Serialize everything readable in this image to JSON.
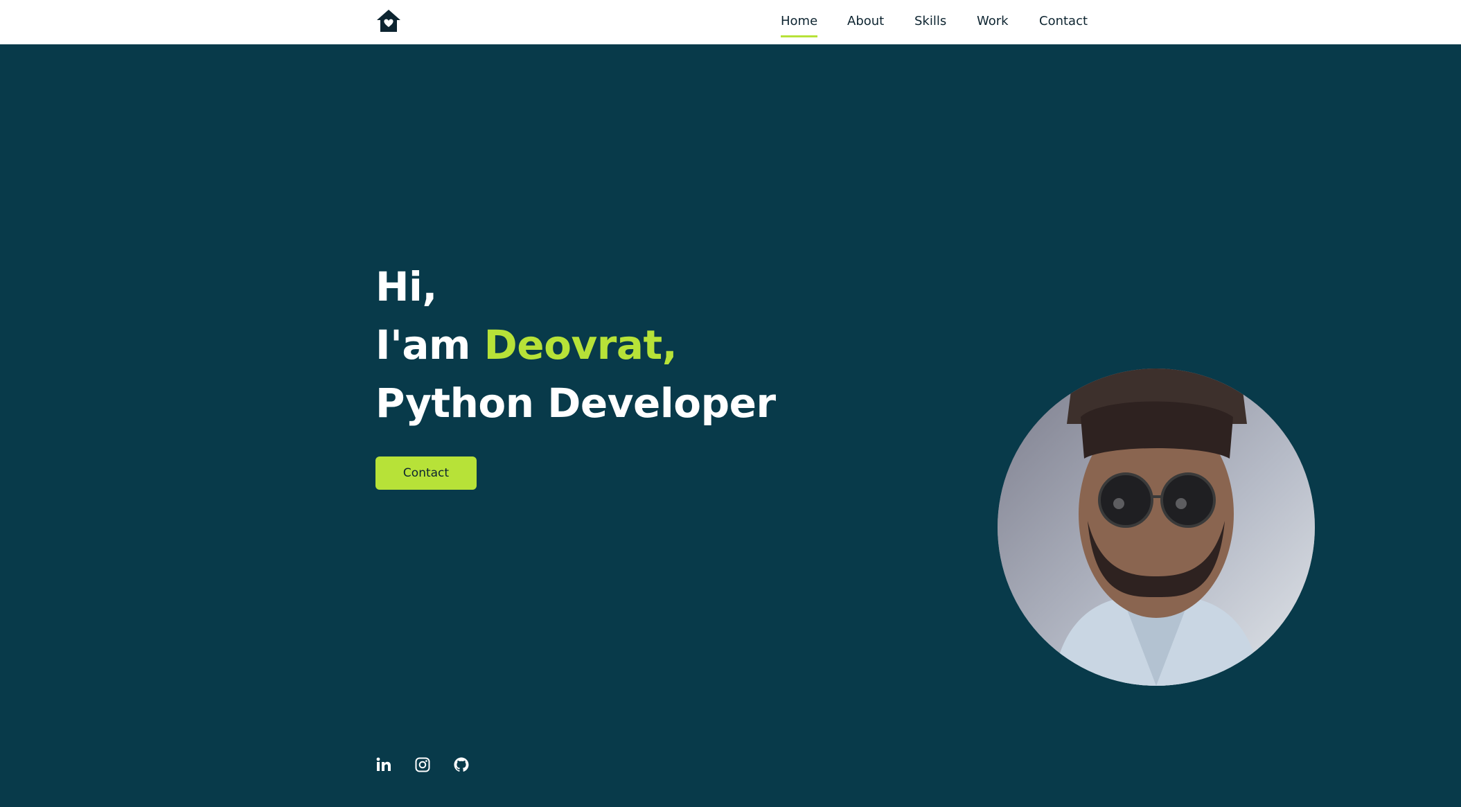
{
  "header": {
    "logo_icon": "home-heart-icon",
    "nav": [
      {
        "label": "Home",
        "active": true
      },
      {
        "label": "About",
        "active": false
      },
      {
        "label": "Skills",
        "active": false
      },
      {
        "label": "Work",
        "active": false
      },
      {
        "label": "Contact",
        "active": false
      }
    ]
  },
  "hero": {
    "greeting": "Hi,",
    "intro_prefix": "I'am ",
    "name": "Deovrat,",
    "role": "Python Developer",
    "button_label": "Contact"
  },
  "social": [
    {
      "icon": "linkedin-icon"
    },
    {
      "icon": "instagram-icon"
    },
    {
      "icon": "github-icon"
    }
  ],
  "colors": {
    "background": "#083a4a",
    "accent": "#b7e238",
    "header_bg": "#ffffff",
    "text_dark": "#0d2430"
  }
}
